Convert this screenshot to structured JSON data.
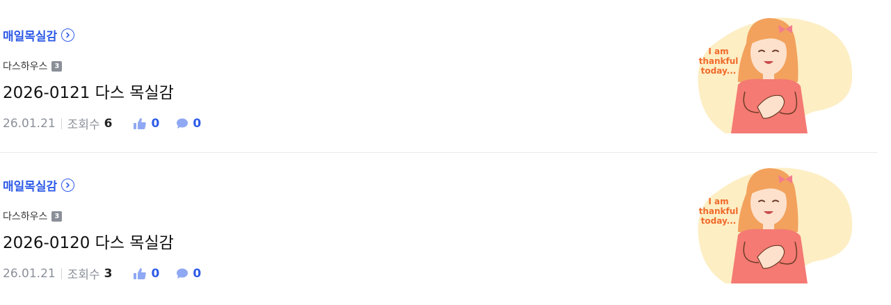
{
  "posts": [
    {
      "board": "매일목실감",
      "author": "다스하우스",
      "level": "3",
      "title": "2026-0121 다스 목실감",
      "date": "26.01.21",
      "views_label": "조회수",
      "views": "6",
      "likes": "0",
      "comments": "0",
      "thumbnail_text": [
        "I am",
        "thankful",
        "today..."
      ]
    },
    {
      "board": "매일목실감",
      "author": "다스하우스",
      "level": "3",
      "title": "2026-0120 다스 목실감",
      "date": "26.01.21",
      "views_label": "조회수",
      "views": "3",
      "likes": "0",
      "comments": "0",
      "thumbnail_text": [
        "I am",
        "thankful",
        "today..."
      ]
    }
  ],
  "colors": {
    "accent": "#2d5ae8",
    "thumb_bg": "#fdeec4",
    "thumb_text": "#f06a2b",
    "hair": "#f2a25d",
    "shirt": "#f47a73"
  }
}
